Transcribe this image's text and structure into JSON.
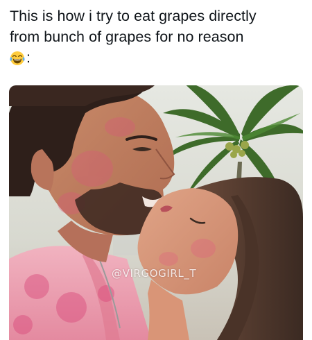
{
  "post": {
    "caption_line1": "This is how i try to eat grapes directly",
    "caption_line2": "from bunch of grapes for no reason",
    "caption_line3_suffix": ":",
    "emoji": "face-with-tears-of-joy-icon"
  },
  "image": {
    "watermark": "@VIRGOGIRL_T"
  }
}
